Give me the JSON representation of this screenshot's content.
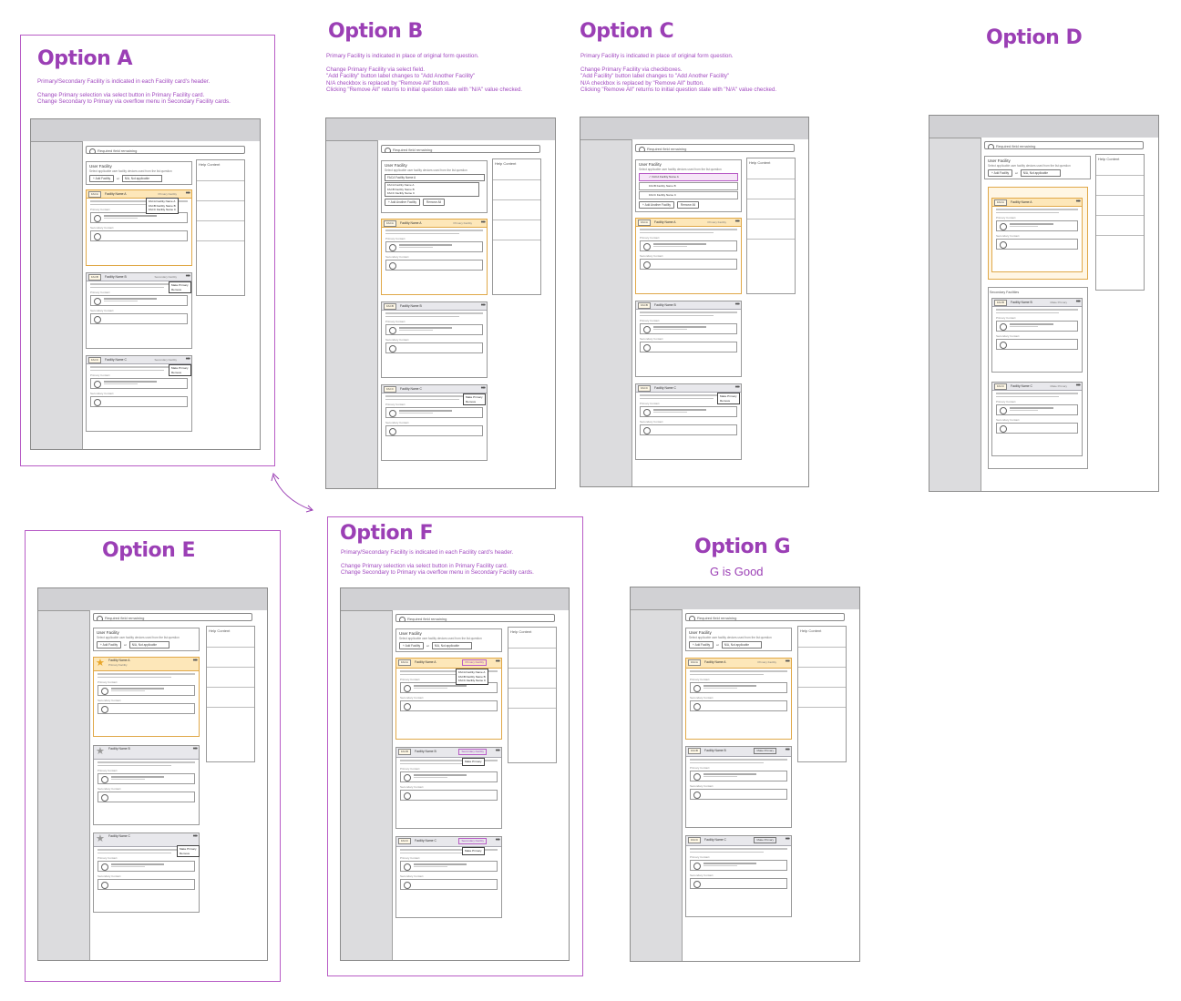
{
  "options": [
    {
      "id": "A",
      "title": "Option A",
      "notes": [
        "Primary/Secondary Facility is indicated in each Facility card's header.",
        "",
        "Change Primary selection via select button in Primary Facility card.",
        "Change Secondary to Primary via overflow menu in Secondary Facility cards."
      ]
    },
    {
      "id": "B",
      "title": "Option B",
      "notes": [
        "Primary Facility is indicated in place of original form question.",
        "",
        "Change Primary Facility via select field.",
        "\"Add Facility\" button label changes to \"Add Another Facility\"",
        "N/A checkbox is replaced by \"Remove All\" button.",
        "Clicking \"Remove All\" returns to initial question state with \"N/A\" value checked."
      ]
    },
    {
      "id": "C",
      "title": "Option C",
      "notes": [
        "Primary Facility is indicated in place of original form question.",
        "",
        "Change Primary Facility via checkboxes.",
        "\"Add Facility\" button label changes to \"Add Another Facility\"",
        "N/A checkbox is replaced by \"Remove All\" button.",
        "Clicking \"Remove All\" returns to initial question state with \"N/A\" value checked."
      ]
    },
    {
      "id": "D",
      "title": "Option D"
    },
    {
      "id": "E",
      "title": "Option E"
    },
    {
      "id": "F",
      "title": "Option F",
      "notes": [
        "Primary/Secondary Facility is indicated in each Facility card's header.",
        "",
        "Change Primary selection via select button in Primary Facility card.",
        "Change Secondary to Primary via overflow menu in Secondary Facility cards."
      ]
    },
    {
      "id": "G",
      "title": "Option G",
      "subtitle": "G is Good"
    }
  ],
  "wire": {
    "required": "Required field remaining",
    "user_facility": "User Facility",
    "uf_desc": "Select applicable user facility devices used from the list question",
    "add_facility": "+ Add Facility",
    "add_another": "+ Add Another Facility",
    "remove_all": "Remove All",
    "or": "or",
    "na": "N/A, Not applicable",
    "help": "Help Content",
    "primary_facility_label": "Primary Facility",
    "secondary_facilities_label": "Secondary Facilities",
    "facility_a": "Facility Name A",
    "facility_b": "Facility Name B",
    "facility_c": "Facility Name C",
    "tag_a": "FACA",
    "tag_b": "FACB",
    "tag_c": "FACC",
    "status_primary": "Primary Facility",
    "status_secondary": "Secondary Facility",
    "make_primary": "Make Primary",
    "remove": "Remove",
    "primary_contact": "Primary Contact",
    "secondary_contact": "Secondary Contact",
    "select_opts": [
      "FACA Facility Name A",
      "FACB Facility Name B",
      "FACC Facility Name C"
    ]
  }
}
